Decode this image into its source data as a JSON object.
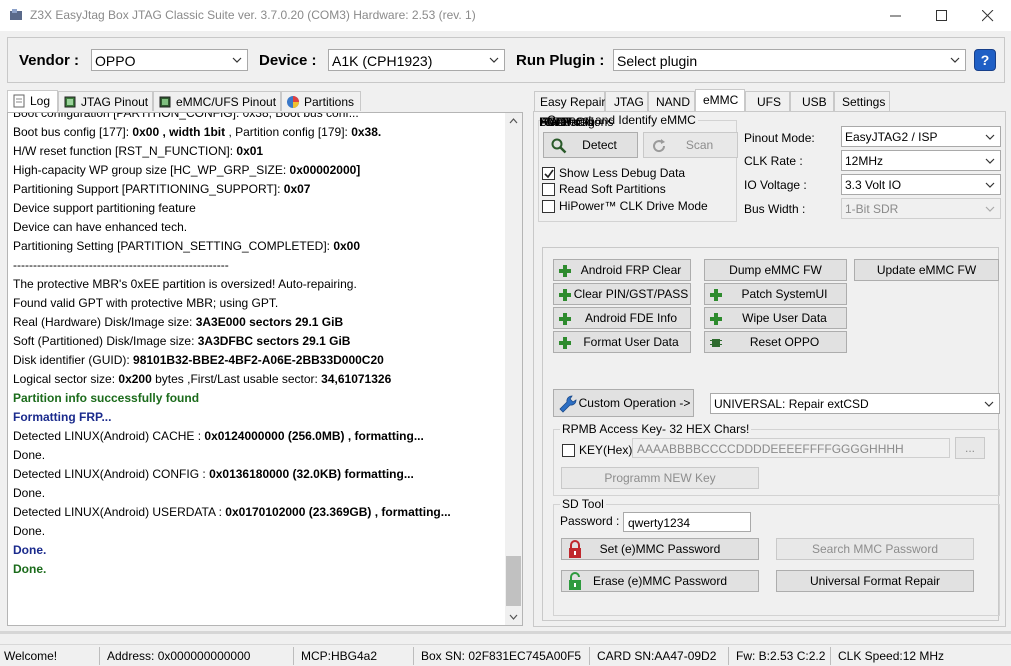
{
  "window": {
    "title": "Z3X EasyJtag Box JTAG Classic Suite ver. 3.7.0.20 (COM3) Hardware: 2.53 (rev. 1)"
  },
  "topbar": {
    "vendor_label": "Vendor :",
    "vendor_value": "OPPO",
    "device_label": "Device :",
    "device_value": "A1K (CPH1923)",
    "plugin_label": "Run Plugin :",
    "plugin_value": "Select plugin",
    "help": "?"
  },
  "left_tabs": [
    "Log",
    "JTAG Pinout",
    "eMMC/UFS Pinout",
    "Partitions"
  ],
  "log_lines": [
    {
      "pre": "Boot bus config [177]: ",
      "b": "0x00 , width 1bit",
      "mid": "  , Partition config [179]: ",
      "b2": "0x38.",
      "color": "#000"
    },
    {
      "pre": "H/W reset function [RST_N_FUNCTION]: ",
      "b": "0x01",
      "mid": "",
      "b2": "",
      "color": "#000"
    },
    {
      "pre": "High-capacity WP group size [HC_WP_GRP_SIZE: ",
      "b": "0x00002000]",
      "mid": "",
      "b2": "",
      "color": "#000"
    },
    {
      "pre": "Partitioning Support [PARTITIONING_SUPPORT]: ",
      "b": "0x07",
      "mid": "",
      "b2": "",
      "color": "#000"
    },
    {
      "pre": " Device support partitioning feature",
      "b": "",
      "mid": "",
      "b2": "",
      "color": "#000"
    },
    {
      "pre": " Device can have enhanced tech.",
      "b": "",
      "mid": "",
      "b2": "",
      "color": "#000"
    },
    {
      "pre": "Partitioning Setting [PARTITION_SETTING_COMPLETED]: ",
      "b": "0x00",
      "mid": "",
      "b2": "",
      "color": "#000"
    },
    {
      "pre": "------------------------------------------------------",
      "b": "",
      "mid": "",
      "b2": "",
      "color": "#000"
    },
    {
      "pre": "The protective MBR's 0xEE partition is oversized! Auto-repairing.",
      "b": "",
      "mid": "",
      "b2": "",
      "color": "#000"
    },
    {
      "pre": "Found valid GPT with protective MBR; using GPT.",
      "b": "",
      "mid": "",
      "b2": "",
      "color": "#000"
    },
    {
      "pre": "Real (Hardware) Disk/Image size: ",
      "b": "3A3E000 sectors 29.1 GiB",
      "mid": "",
      "b2": "",
      "color": "#000"
    },
    {
      "pre": "Soft (Partitioned) Disk/Image size: ",
      "b": "3A3DFBC sectors 29.1 GiB",
      "mid": "",
      "b2": "",
      "color": "#000"
    },
    {
      "pre": "Disk identifier (GUID): ",
      "b": "98101B32-BBE2-4BF2-A06E-2BB33D000C20",
      "mid": "",
      "b2": "",
      "color": "#000"
    },
    {
      "pre": "Logical sector size: ",
      "b": "0x200",
      "mid": "  bytes ,First/Last usable sector: ",
      "b2": "34,61071326",
      "color": "#000"
    },
    {
      "pre": "",
      "b": "Partition info successfully found",
      "mid": "",
      "b2": "",
      "color": "#1b6b1b"
    },
    {
      "pre": "",
      "b": "Formatting FRP...",
      "mid": "",
      "b2": "",
      "color": "#1a2a8c"
    },
    {
      "pre": "Detected LINUX(Android) CACHE : ",
      "b": "0x0124000000 (256.0MB) , formatting...",
      "mid": "",
      "b2": "",
      "color": "#000"
    },
    {
      "pre": "Done.",
      "b": "",
      "mid": "",
      "b2": "",
      "color": "#000"
    },
    {
      "pre": "Detected LINUX(Android) CONFIG : ",
      "b": "0x0136180000 (32.0KB) formatting...",
      "mid": "",
      "b2": "",
      "color": "#000"
    },
    {
      "pre": "Done.",
      "b": "",
      "mid": "",
      "b2": "",
      "color": "#000"
    },
    {
      "pre": "Detected LINUX(Android) USERDATA : ",
      "b": "0x0170102000 (23.369GB) , formatting...",
      "mid": "",
      "b2": "",
      "color": "#000"
    },
    {
      "pre": "Done.",
      "b": "",
      "mid": "",
      "b2": "",
      "color": "#000"
    },
    {
      "pre": "",
      "b": "Done.",
      "mid": "",
      "b2": "",
      "color": "#1a2a8c"
    },
    {
      "pre": "",
      "b": "Done.",
      "mid": "",
      "b2": "",
      "color": "#1b6b1b"
    }
  ],
  "right_tabs": [
    "Easy Repair",
    "JTAG",
    "NAND",
    "eMMC",
    "UFS",
    "USB",
    "Settings"
  ],
  "connect": {
    "group_title": "Connect and Identify eMMC",
    "detect": "Detect",
    "scan": "Scan",
    "show_less_debug": "Show Less Debug Data",
    "read_soft_partitions": "Read Soft Partitions",
    "hipower": "HiPower™ CLK Drive Mode",
    "pinout_label": "Pinout Mode:",
    "pinout_value": "EasyJTAG2 / ISP",
    "clk_label": "CLK Rate :",
    "clk_value": "12MHz",
    "io_label": "IO Voltage :",
    "io_value": "3.3 Volt IO",
    "bus_label": "Bus Width :",
    "bus_value": "1-Bit SDR"
  },
  "sub_tabs": [
    "Flasher",
    "BOOT Cfg.",
    "Advanced",
    "HW Partitions",
    "OTP"
  ],
  "advanced": {
    "android_frp_clear": "Android FRP Clear",
    "dump_emmc_fw": "Dump eMMC FW",
    "update_emmc_fw": "Update eMMC FW",
    "clear_pin": "Clear PIN/GST/PASS",
    "patch_systemui": "Patch SystemUI",
    "android_fde_info": "Android FDE Info",
    "wipe_user_data": "Wipe User Data",
    "format_user_data": "Format User Data",
    "reset_oppo": "Reset OPPO",
    "custom_operation": "Custom Operation ->",
    "custom_value": "UNIVERSAL: Repair extCSD"
  },
  "rpmb": {
    "group_title": "RPMB Access Key- 32 HEX Chars!",
    "key_label": "KEY(Hex) :",
    "key_placeholder": "AAAABBBBCCCCDDDDEEEEFFFFGGGGHHHH",
    "browse": "...",
    "program": "Programm NEW Key"
  },
  "sdtool": {
    "group_title": "SD Tool",
    "password_label": "Password :",
    "password_value": "qwerty1234",
    "set_password": "Set (e)MMC Password",
    "search_password": "Search MMC Password",
    "erase_password": "Erase (e)MMC Password",
    "universal_format": "Universal Format Repair"
  },
  "statusbar": {
    "welcome": "Welcome!",
    "address": "Address: 0x000000000000",
    "mcp": "MCP:HBG4a2",
    "box_sn": "Box SN: 02F831EC745A00F5",
    "card_sn": "CARD SN:AA47-09D2",
    "fw": "Fw: B:2.53 C:2.2",
    "clk_speed": "CLK Speed:12 MHz"
  },
  "colors": {
    "accent_green": "#2e8b2e",
    "help_blue": "#1f5fc5",
    "lock_red": "#c0282d",
    "lock_green": "#2e9a3e"
  }
}
